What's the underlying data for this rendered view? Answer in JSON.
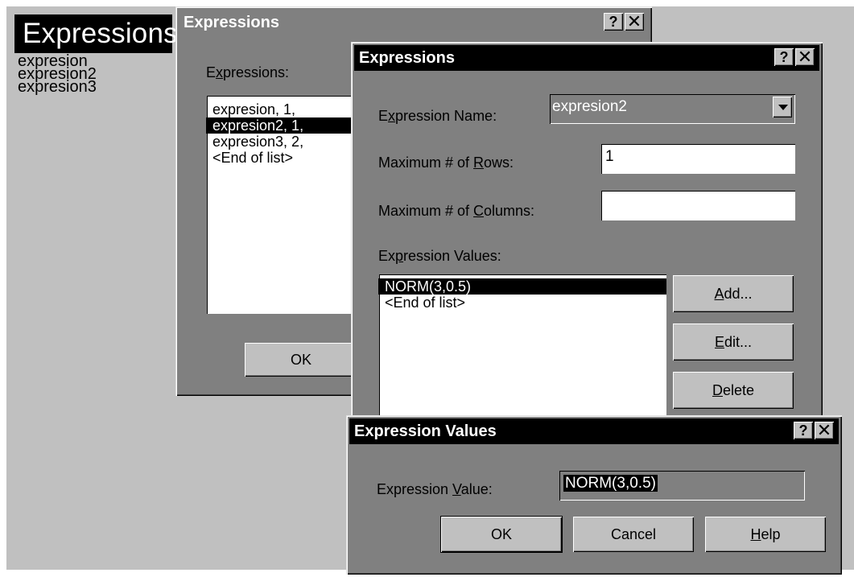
{
  "module": {
    "title": "Expressions",
    "items": [
      "expresion",
      "expresion2",
      "expresion3"
    ]
  },
  "dialog1": {
    "title": "Expressions",
    "list_label_pre": "E",
    "list_label_u": "x",
    "list_label_post": "pressions:",
    "items": [
      "expresion, 1,",
      "expresion2, 1,",
      "expresion3, 2,",
      "<End of list>"
    ],
    "selected_index": 1,
    "ok_label": "OK"
  },
  "dialog2": {
    "title": "Expressions",
    "name_label_pre": "E",
    "name_label_u": "x",
    "name_label_post": "pression Name:",
    "name_value": "expresion2",
    "rows_label_pre": "Maximum # of ",
    "rows_label_u": "R",
    "rows_label_post": "ows:",
    "rows_value": "1",
    "cols_label_pre": "Maximum # of ",
    "cols_label_u": "C",
    "cols_label_post": "olumns:",
    "cols_value": "",
    "values_label_pre": "Ex",
    "values_label_u": "p",
    "values_label_post": "ression Values:",
    "values": [
      "NORM(3,0.5)",
      "<End of list>"
    ],
    "add_u": "A",
    "add_rest": "dd...",
    "edit_u": "E",
    "edit_rest": "dit...",
    "delete_u": "D",
    "delete_rest": "elete"
  },
  "dialog3": {
    "title": "Expression Values",
    "value_label_pre": "Expression ",
    "value_label_u": "V",
    "value_label_post": "alue:",
    "value": "NORM(3,0.5)",
    "ok_label": "OK",
    "cancel_label": "Cancel",
    "help_u": "H",
    "help_rest": "elp"
  },
  "titlebar_buttons": {
    "help": "?",
    "close": "✕"
  },
  "colors": {
    "face": "#c0c0c0",
    "window_bg": "#808080",
    "highlight": "#000000"
  }
}
